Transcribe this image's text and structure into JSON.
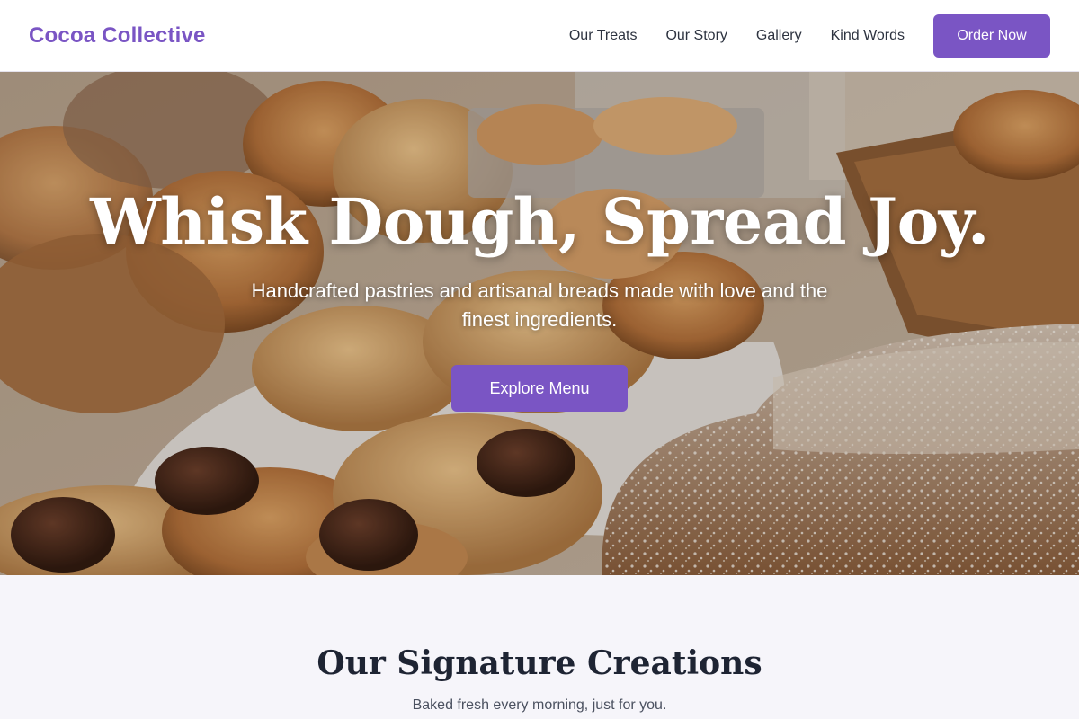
{
  "header": {
    "brand": "Cocoa Collective",
    "nav": [
      "Our Treats",
      "Our Story",
      "Gallery",
      "Kind Words"
    ],
    "cta": "Order Now"
  },
  "hero": {
    "title": "Whisk Dough, Spread Joy.",
    "subtitle": "Handcrafted pastries and artisanal breads made with love and the finest ingredients.",
    "cta": "Explore Menu",
    "image": "bakery-pastries-photo"
  },
  "signature": {
    "title": "Our Signature Creations",
    "subtitle": "Baked fresh every morning, just for you."
  },
  "colors": {
    "accent": "#7a55c4",
    "heading": "#1e2433",
    "section_bg": "#f6f5fa"
  }
}
